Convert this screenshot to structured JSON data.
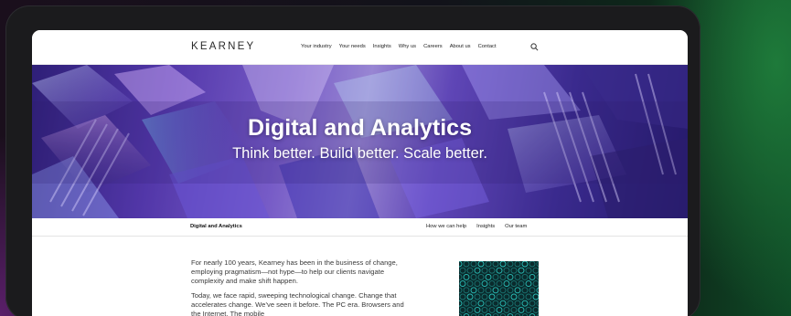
{
  "site": {
    "logo": "KEARNEY",
    "nav": [
      "Your industry",
      "Your needs",
      "Insights",
      "Why us",
      "Careers",
      "About us",
      "Contact"
    ]
  },
  "hero": {
    "title": "Digital and Analytics",
    "subtitle": "Think better. Build better. Scale better."
  },
  "subnav": {
    "title": "Digital and Analytics",
    "links": [
      "How we can help",
      "Insights",
      "Our team"
    ]
  },
  "body": {
    "paragraphs": [
      "For nearly 100 years, Kearney has been in the business of change, employing pragmatism—not hype—to help our clients navigate complexity and make shift happen.",
      "Today, we face rapid, sweeping technological change. Change that accelerates change. We’ve seen it before. The PC era. Browsers and the Internet. The mobile"
    ]
  },
  "colors": {
    "hero_accent": "#6b4fc2",
    "image_teal": "#2fd0c8"
  }
}
